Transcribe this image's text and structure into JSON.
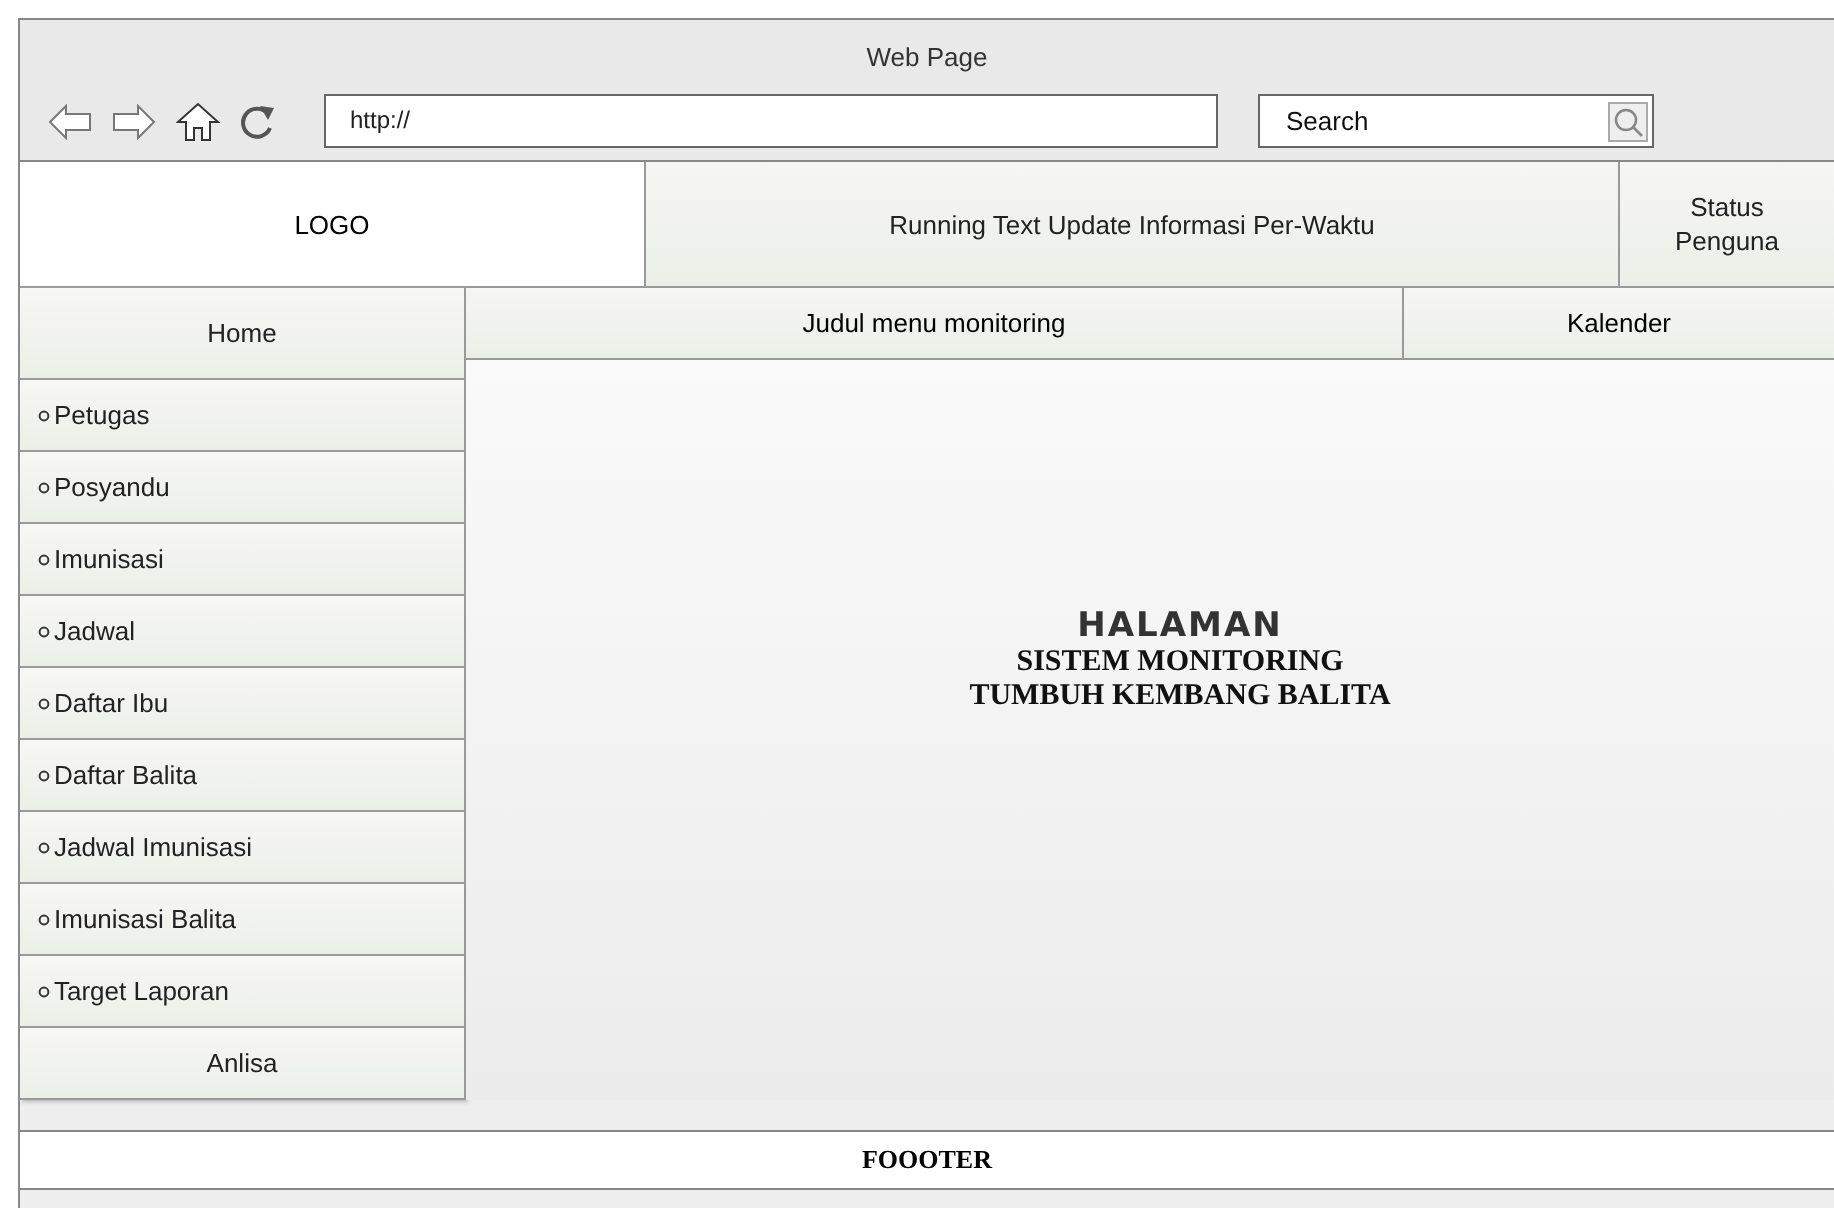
{
  "window": {
    "title": "Web Page"
  },
  "browser": {
    "address": "http://",
    "search_placeholder": "Search"
  },
  "header": {
    "logo": "LOGO",
    "running_text": "Running Text Update Informasi Per-Waktu",
    "status": "Status\nPenguna"
  },
  "nav": {
    "title": "Judul menu monitoring",
    "calendar": "Kalender"
  },
  "sidebar": {
    "items": [
      {
        "label": "Home",
        "kind": "plain"
      },
      {
        "label": "Petugas",
        "kind": "bullet"
      },
      {
        "label": "Posyandu",
        "kind": "bullet"
      },
      {
        "label": "Imunisasi",
        "kind": "bullet"
      },
      {
        "label": "Jadwal",
        "kind": "bullet"
      },
      {
        "label": "Daftar Ibu",
        "kind": "bullet"
      },
      {
        "label": "Daftar Balita",
        "kind": "bullet"
      },
      {
        "label": "Jadwal Imunisasi",
        "kind": "bullet"
      },
      {
        "label": "Imunisasi Balita",
        "kind": "bullet"
      },
      {
        "label": "Target Laporan",
        "kind": "bullet"
      },
      {
        "label": "Anlisa",
        "kind": "plain"
      }
    ]
  },
  "content": {
    "heading": "HALAMAN",
    "subheading": [
      "SISTEM MONITORING",
      "TUMBUH KEMBANG BALITA"
    ]
  },
  "footer": "FOOOTER"
}
